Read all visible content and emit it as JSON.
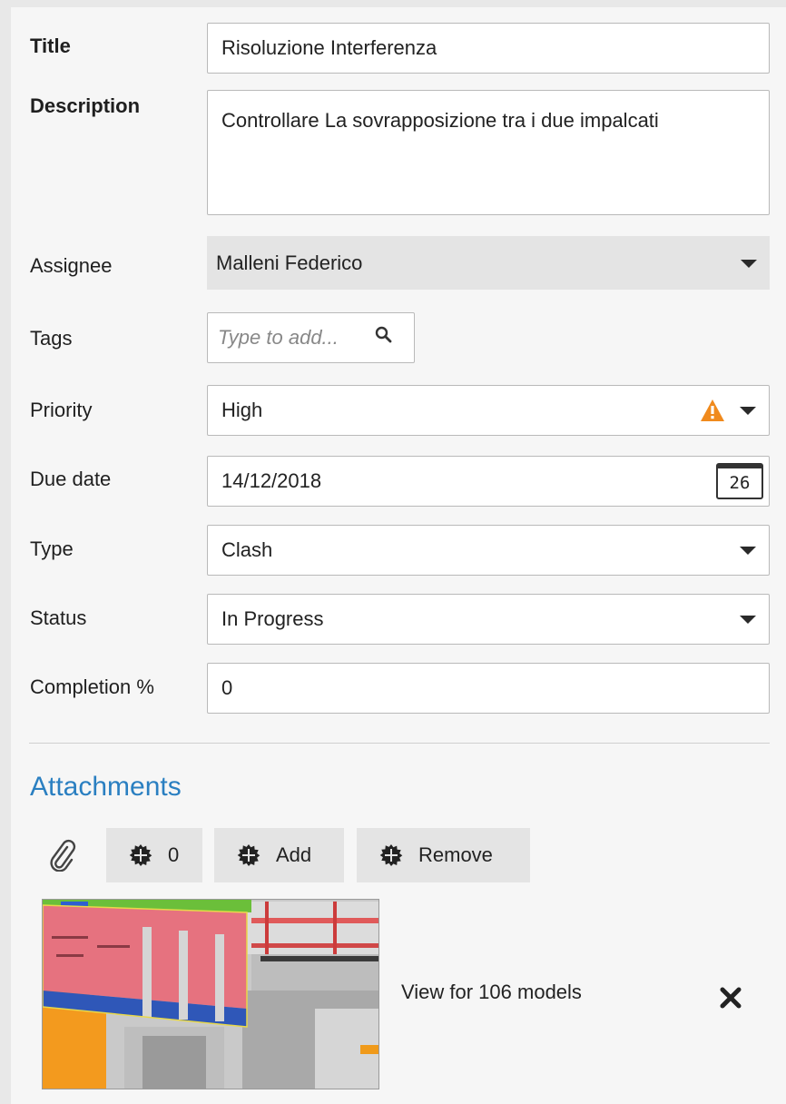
{
  "form": {
    "title": {
      "label": "Title",
      "value": "Risoluzione Interferenza"
    },
    "description": {
      "label": "Description",
      "value": "Controllare La sovrapposizione tra i due impalcati"
    },
    "assignee": {
      "label": "Assignee",
      "value": "Malleni Federico"
    },
    "tags": {
      "label": "Tags",
      "placeholder": "Type to add..."
    },
    "priority": {
      "label": "Priority",
      "value": "High",
      "icon": "warning-icon",
      "icon_color": "#f08a1d"
    },
    "due_date": {
      "label": "Due date",
      "value": "14/12/2018",
      "calendar_day": "26"
    },
    "type": {
      "label": "Type",
      "value": "Clash"
    },
    "status": {
      "label": "Status",
      "value": "In Progress"
    },
    "completion": {
      "label": "Completion %",
      "value": "0"
    }
  },
  "attachments": {
    "title": "Attachments",
    "title_color": "#2a7fc1",
    "count_button": "0",
    "add_button": "Add",
    "remove_button": "Remove",
    "item": {
      "text": "View for 106 models"
    }
  }
}
